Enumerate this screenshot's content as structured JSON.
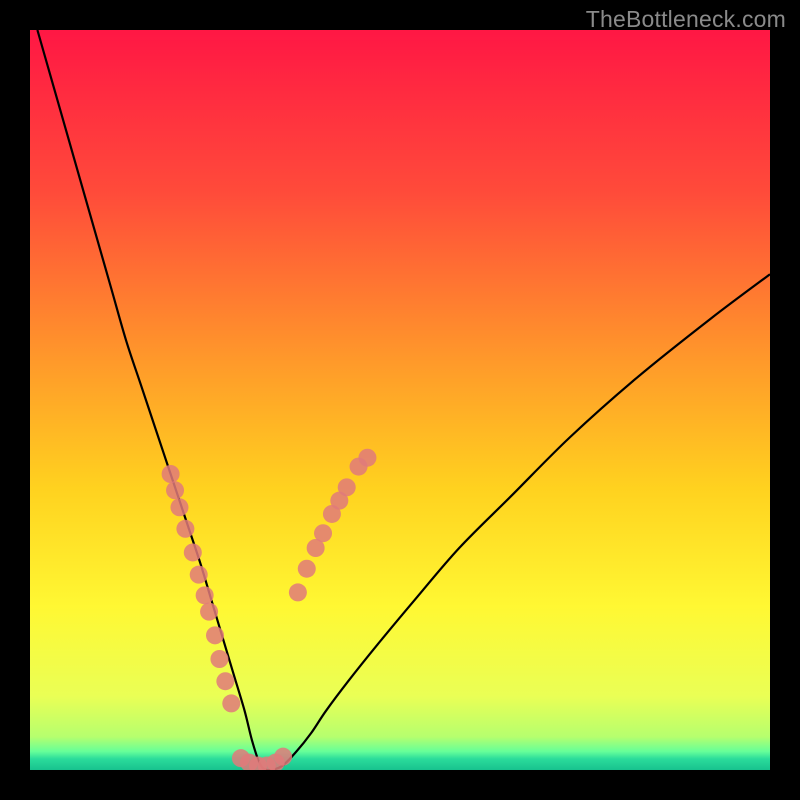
{
  "watermark": "TheBottleneck.com",
  "chart_data": {
    "type": "line",
    "title": "",
    "xlabel": "",
    "ylabel": "",
    "xlim": [
      0,
      100
    ],
    "ylim": [
      0,
      100
    ],
    "background": {
      "kind": "vertical-gradient",
      "stops": [
        {
          "pos": 0.0,
          "color": "#ff1744"
        },
        {
          "pos": 0.22,
          "color": "#ff4b3a"
        },
        {
          "pos": 0.45,
          "color": "#ff9a2a"
        },
        {
          "pos": 0.62,
          "color": "#ffd21f"
        },
        {
          "pos": 0.78,
          "color": "#fff833"
        },
        {
          "pos": 0.9,
          "color": "#eaff55"
        },
        {
          "pos": 0.955,
          "color": "#b6ff6e"
        },
        {
          "pos": 0.975,
          "color": "#66ff99"
        },
        {
          "pos": 0.985,
          "color": "#2bdc9b"
        },
        {
          "pos": 1.0,
          "color": "#18c28e"
        }
      ]
    },
    "series": [
      {
        "name": "bottleneck-curve",
        "kind": "curve",
        "x": [
          1,
          3,
          5,
          7,
          9,
          11,
          13,
          15,
          17,
          19,
          21,
          23,
          24.5,
          26,
          27.5,
          29,
          30,
          31,
          32,
          34,
          36,
          38,
          40,
          43,
          47,
          52,
          58,
          65,
          73,
          82,
          92,
          100
        ],
        "y": [
          100,
          93,
          86,
          79,
          72,
          65,
          58,
          52,
          46,
          40,
          34,
          28,
          23,
          18,
          13,
          8,
          4,
          1,
          0,
          0.5,
          2.5,
          5,
          8,
          12,
          17,
          23,
          30,
          37,
          45,
          53,
          61,
          67
        ]
      },
      {
        "name": "curve-markers-left",
        "kind": "markers",
        "x": [
          19.0,
          19.6,
          20.2,
          21.0,
          22.0,
          22.8,
          23.6,
          24.2,
          25.0,
          25.6,
          26.4,
          27.2
        ],
        "y": [
          40.0,
          37.8,
          35.5,
          32.6,
          29.4,
          26.4,
          23.6,
          21.4,
          18.2,
          15.0,
          12.0,
          9.0
        ]
      },
      {
        "name": "curve-markers-right",
        "kind": "markers",
        "x": [
          36.2,
          37.4,
          38.6,
          39.6,
          40.8,
          41.8,
          42.8,
          44.4,
          45.6
        ],
        "y": [
          24.0,
          27.2,
          30.0,
          32.0,
          34.6,
          36.4,
          38.2,
          41.0,
          42.2
        ]
      },
      {
        "name": "bottom-cluster",
        "kind": "markers",
        "x": [
          28.5,
          29.6,
          30.8,
          32.0,
          33.2,
          34.2
        ],
        "y": [
          1.6,
          1.0,
          0.6,
          0.6,
          1.0,
          1.8
        ]
      }
    ]
  }
}
